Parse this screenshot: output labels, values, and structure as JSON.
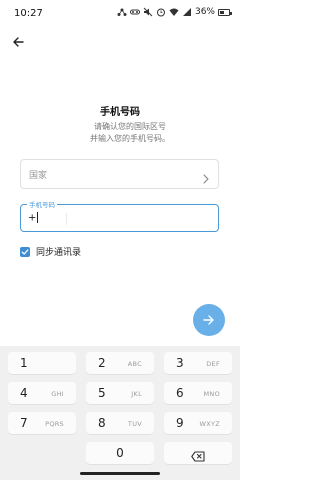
{
  "status_bar": {
    "time": "10:27",
    "battery_text": "36%",
    "battery_level": 0.36
  },
  "header": {
    "title": "手机号码",
    "subtitle_line1": "请确认您的国际区号",
    "subtitle_line2": "并输入您的手机号码。"
  },
  "country_field": {
    "placeholder": "国家"
  },
  "phone_field": {
    "floating_label": "手机号码",
    "value": "+"
  },
  "sync_contacts": {
    "label": "同步通讯录",
    "checked": true
  },
  "colors": {
    "accent": "#4b9ad8",
    "fab": "#6ab0e8",
    "checkbox": "#3f8ed3",
    "keyboard_bg": "#f0f0f0"
  },
  "keyboard": {
    "keys": [
      {
        "digit": "1",
        "letters": ""
      },
      {
        "digit": "2",
        "letters": "ABC"
      },
      {
        "digit": "3",
        "letters": "DEF"
      },
      {
        "digit": "4",
        "letters": "GHI"
      },
      {
        "digit": "5",
        "letters": "JKL"
      },
      {
        "digit": "6",
        "letters": "MNO"
      },
      {
        "digit": "7",
        "letters": "PQRS"
      },
      {
        "digit": "8",
        "letters": "TUV"
      },
      {
        "digit": "9",
        "letters": "WXYZ"
      },
      {
        "digit": "+",
        "letters": ""
      },
      {
        "digit": "0",
        "letters": "+"
      }
    ],
    "backspace_icon": "backspace-icon"
  }
}
